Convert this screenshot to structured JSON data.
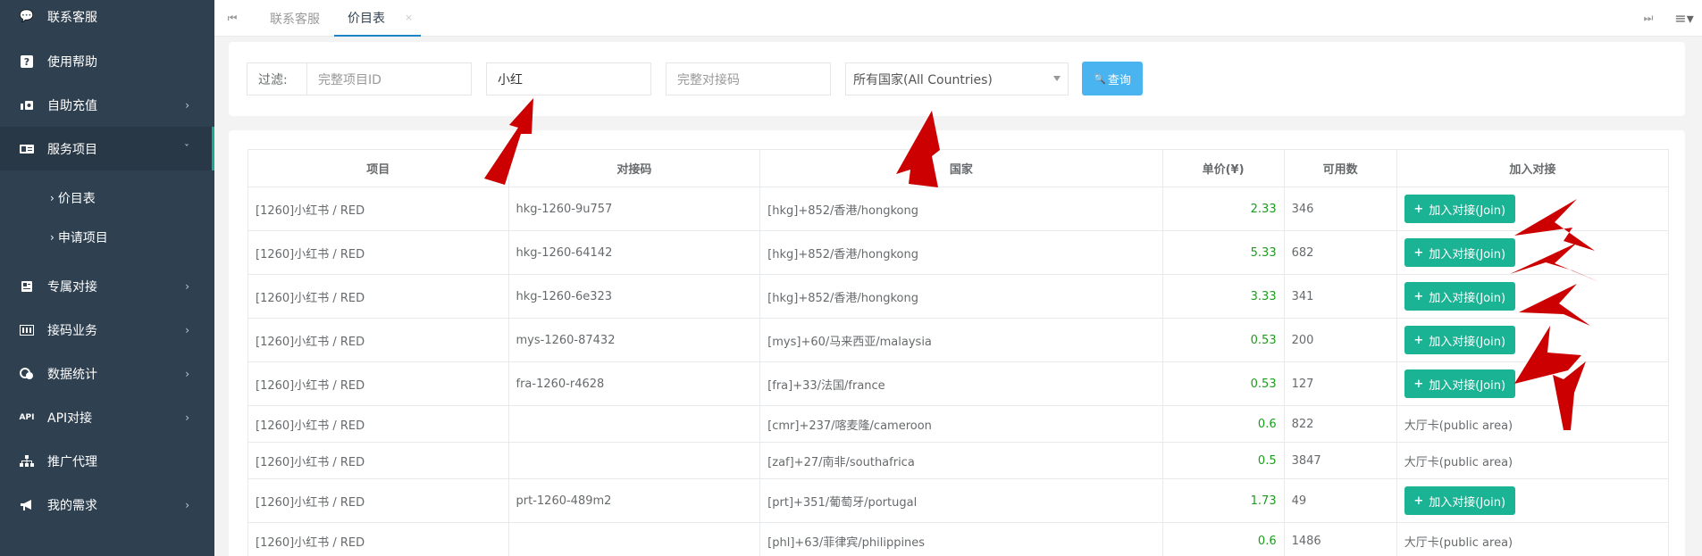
{
  "sidebar": {
    "items": [
      {
        "label": "联系客服",
        "icon": "chat-icon",
        "chevron": false
      },
      {
        "label": "使用帮助",
        "icon": "question-icon",
        "chevron": false
      },
      {
        "label": "自助充值",
        "icon": "money-icon",
        "chevron": true
      },
      {
        "label": "服务项目",
        "icon": "card-icon",
        "chevron": true,
        "active": true
      },
      {
        "label": "专属对接",
        "icon": "doc-icon",
        "chevron": true
      },
      {
        "label": "接码业务",
        "icon": "grid-icon",
        "chevron": true
      },
      {
        "label": "数据统计",
        "icon": "coins-icon",
        "chevron": true
      },
      {
        "label": "API对接",
        "icon": "api-icon",
        "chevron": true
      },
      {
        "label": "推广代理",
        "icon": "sitemap-icon",
        "chevron": false
      },
      {
        "label": "我的需求",
        "icon": "bullhorn-icon",
        "chevron": true
      }
    ],
    "sub_items": [
      {
        "label": "价目表"
      },
      {
        "label": "申请项目"
      }
    ]
  },
  "tabbar": {
    "tabs": [
      {
        "label": "联系客服",
        "active": false
      },
      {
        "label": "价目表",
        "active": true,
        "closable": true
      }
    ],
    "close_glyph": "×"
  },
  "filter": {
    "label": "过滤:",
    "project_id_placeholder": "完整项目ID",
    "keyword_value": "小红",
    "code_placeholder": "完整对接码",
    "country_selected": "所有国家(All Countries)",
    "query_label": "查询"
  },
  "table": {
    "headers": [
      "项目",
      "对接码",
      "国家",
      "单价(¥)",
      "可用数",
      "加入对接"
    ],
    "rows": [
      {
        "project": "[1260]小红书 / RED",
        "code": "hkg-1260-9u757",
        "country": "[hkg]+852/香港/hongkong",
        "price": "2.33",
        "available": "346",
        "action": "加入对接(Join)",
        "joinable": true
      },
      {
        "project": "[1260]小红书 / RED",
        "code": "hkg-1260-64142",
        "country": "[hkg]+852/香港/hongkong",
        "price": "5.33",
        "available": "682",
        "action": "加入对接(Join)",
        "joinable": true
      },
      {
        "project": "[1260]小红书 / RED",
        "code": "hkg-1260-6e323",
        "country": "[hkg]+852/香港/hongkong",
        "price": "3.33",
        "available": "341",
        "action": "加入对接(Join)",
        "joinable": true
      },
      {
        "project": "[1260]小红书 / RED",
        "code": "mys-1260-87432",
        "country": "[mys]+60/马来西亚/malaysia",
        "price": "0.53",
        "available": "200",
        "action": "加入对接(Join)",
        "joinable": true
      },
      {
        "project": "[1260]小红书 / RED",
        "code": "fra-1260-r4628",
        "country": "[fra]+33/法国/france",
        "price": "0.53",
        "available": "127",
        "action": "加入对接(Join)",
        "joinable": true
      },
      {
        "project": "[1260]小红书 / RED",
        "code": "",
        "country": "[cmr]+237/喀麦隆/cameroon",
        "price": "0.6",
        "available": "822",
        "action": "大厅卡(public area)",
        "joinable": false
      },
      {
        "project": "[1260]小红书 / RED",
        "code": "",
        "country": "[zaf]+27/南非/southafrica",
        "price": "0.5",
        "available": "3847",
        "action": "大厅卡(public area)",
        "joinable": false
      },
      {
        "project": "[1260]小红书 / RED",
        "code": "prt-1260-489m2",
        "country": "[prt]+351/葡萄牙/portugal",
        "price": "1.73",
        "available": "49",
        "action": "加入对接(Join)",
        "joinable": true
      },
      {
        "project": "[1260]小红书 / RED",
        "code": "",
        "country": "[phl]+63/菲律宾/philippines",
        "price": "0.6",
        "available": "1486",
        "action": "大厅卡(public area)",
        "joinable": false
      }
    ]
  },
  "colors": {
    "sidebar_bg": "#2f4050",
    "join_green": "#1ab394",
    "price_green": "#1a9e1a",
    "query_blue": "#4ab4f0",
    "arrow_red": "#cc0000"
  }
}
